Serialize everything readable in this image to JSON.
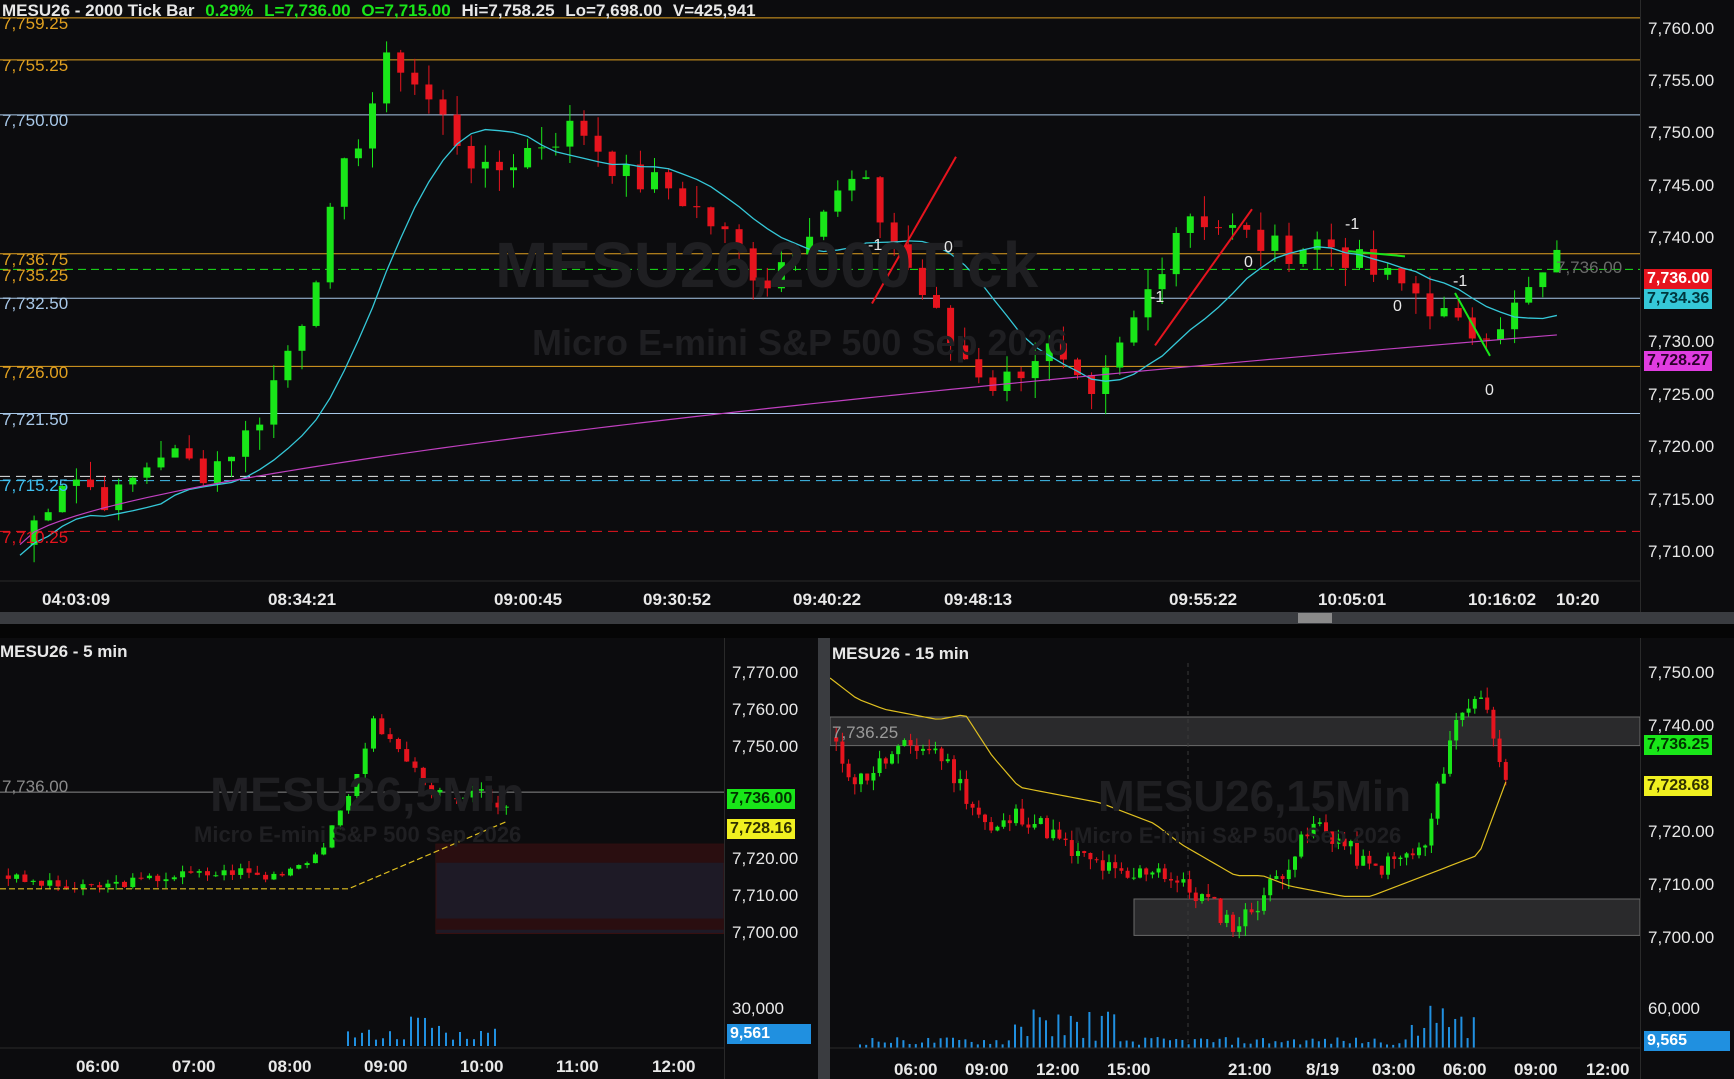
{
  "top_chart": {
    "header": {
      "symbol": "MESU26 - 2000 Tick Bar",
      "change": "0.29%",
      "last": "L=7,736.00",
      "open": "O=7,715.00",
      "high": "Hi=7,758.25",
      "low": "Lo=7,698.00",
      "volume": "V=425,941"
    },
    "watermark_title": "MESU26,2000Tick",
    "watermark_sub": "Micro E-mini S&P 500 Sep 2026",
    "y_ticks": [
      "7,760.00",
      "7,755.00",
      "7,750.00",
      "7,745.00",
      "7,740.00",
      "7,735.00",
      "7,730.00",
      "7,725.00",
      "7,720.00",
      "7,715.00",
      "7,710.00"
    ],
    "x_ticks": [
      "04:03:09",
      "08:34:21",
      "09:00:45",
      "09:30:52",
      "09:40:22",
      "09:48:13",
      "09:55:22",
      "10:05:01",
      "10:16:02",
      "10:20"
    ],
    "level_labels": [
      "7,759.25",
      "7,755.25",
      "7,750.00",
      "7,736.75",
      "7,735.25",
      "7,732.50",
      "7,726.00",
      "7,721.50",
      "7,715.25",
      "7,710.25"
    ],
    "price_tags": {
      "last": "7,736.00",
      "cyan_ma": "7,734.36",
      "magenta_ma": "7,728.27",
      "ghost": "7,736.00"
    },
    "annotations": [
      "-1",
      "0",
      "0",
      "-1",
      "-1",
      "0",
      "-1",
      "0"
    ],
    "colors": {
      "up": "#19e619",
      "down": "#e6141e",
      "cyan_ma": "#35c8d8",
      "magenta_ma": "#c040c0",
      "orange_level": "#e0a020",
      "blue_level": "#a8c8e8"
    }
  },
  "bottom_left": {
    "title": "MESU26 - 5 min",
    "watermark_title": "MESU26,5Min",
    "watermark_sub": "Micro E-mini S&P 500 Sep 2026",
    "y_ticks": [
      "7,770.00",
      "7,760.00",
      "7,750.00",
      "7,740.00",
      "7,730.00",
      "7,720.00",
      "7,710.00",
      "7,700.00"
    ],
    "x_ticks": [
      "06:00",
      "07:00",
      "08:00",
      "09:00",
      "10:00",
      "11:00",
      "12:00"
    ],
    "level_label": "7,736.00",
    "price_tag_last": "7,736.00",
    "price_tag_ma": "7,728.16",
    "volume_tick": "30,000",
    "volume_tag": "9,561"
  },
  "bottom_right": {
    "title": "MESU26 - 15 min",
    "watermark_title": "MESU26,15Min",
    "watermark_sub": "Micro E-mini S&P 500 Sep 2026",
    "y_ticks": [
      "7,750.00",
      "7,740.00",
      "7,730.00",
      "7,720.00",
      "7,710.00",
      "7,700.00"
    ],
    "x_ticks": [
      "06:00",
      "09:00",
      "12:00",
      "15:00",
      "21:00",
      "8/19",
      "03:00",
      "06:00",
      "09:00",
      "12:00"
    ],
    "level_label": "7,736.25",
    "price_tag_last": "7,736.25",
    "price_tag_ma": "7,728.68",
    "volume_tick": "60,000",
    "volume_tag": "9,565"
  }
}
